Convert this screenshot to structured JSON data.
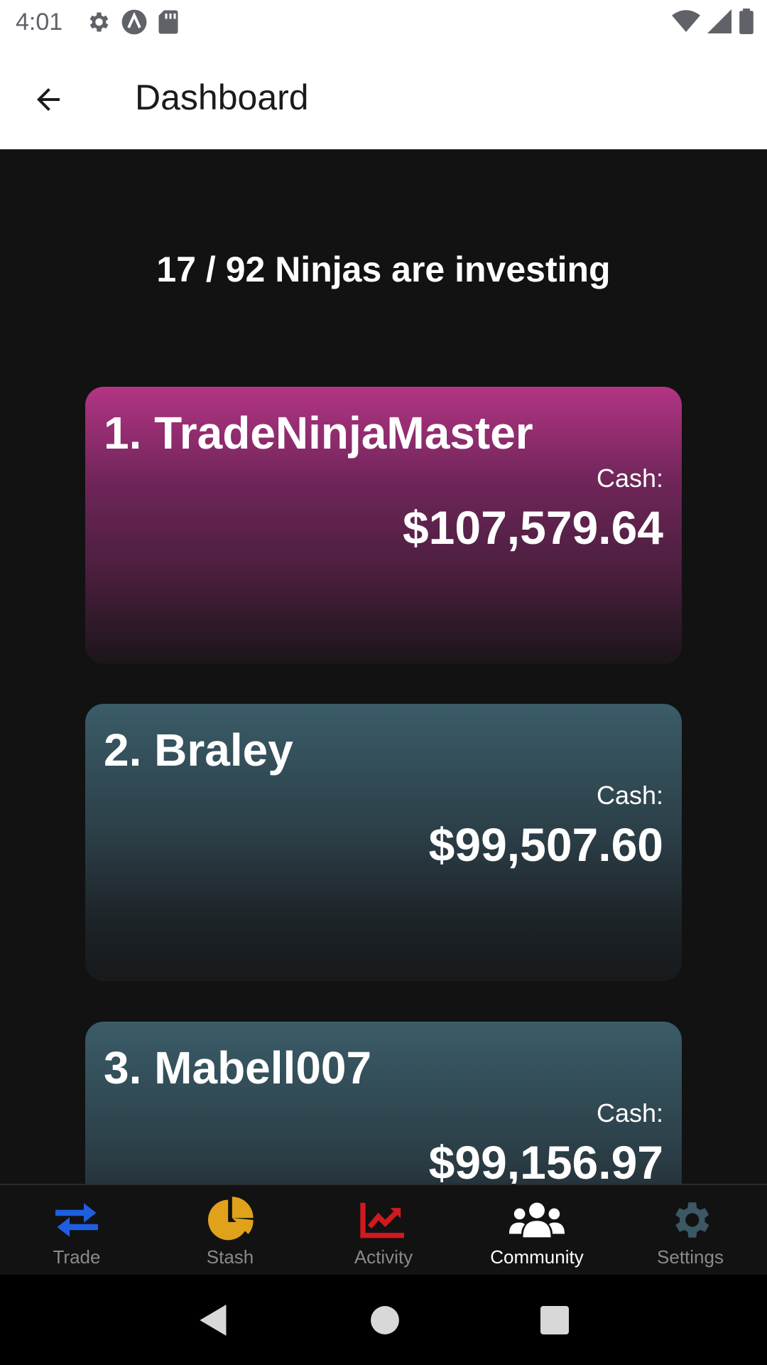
{
  "status_bar": {
    "time": "4:01"
  },
  "app_bar": {
    "title": "Dashboard"
  },
  "headline": "17 / 92 Ninjas are investing",
  "leaderboard": [
    {
      "rank_name": "1. TradeNinjaMaster",
      "cash_label": "Cash:",
      "cash_value": "$107,579.64",
      "accent": "#b33484"
    },
    {
      "rank_name": "2. Braley",
      "cash_label": "Cash:",
      "cash_value": "$99,507.60",
      "accent": "#3a5c68"
    },
    {
      "rank_name": "3. Mabell007",
      "cash_label": "Cash:",
      "cash_value": "$99,156.97",
      "accent": "#3a5c68"
    }
  ],
  "bottom_nav": {
    "items": [
      {
        "label": "Trade",
        "icon": "swap-arrows-icon",
        "color": "#1e5fe0"
      },
      {
        "label": "Stash",
        "icon": "pie-chart-icon",
        "color": "#e0a21a"
      },
      {
        "label": "Activity",
        "icon": "line-chart-icon",
        "color": "#d2191f"
      },
      {
        "label": "Community",
        "icon": "people-icon",
        "color": "#ffffff",
        "active": true
      },
      {
        "label": "Settings",
        "icon": "gear-icon",
        "color": "#3b5864"
      }
    ]
  }
}
